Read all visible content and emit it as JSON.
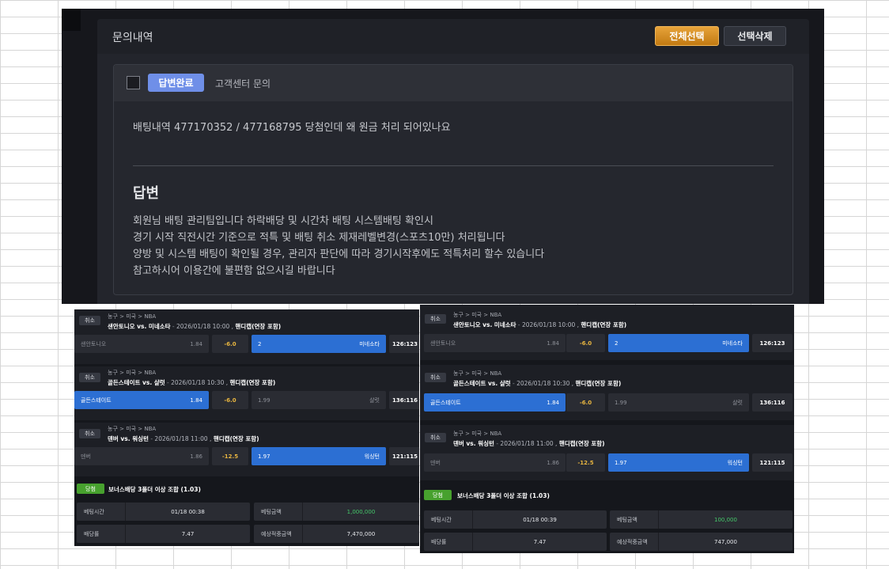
{
  "inquiry": {
    "title": "문의내역",
    "select_all_label": "전체선택",
    "delete_selected_label": "선택삭제",
    "status_badge": "답변완료",
    "category": "고객센터 문의",
    "question": "배팅내역 477170352 / 477168795 당첨인데 왜 원금 처리 되어있나요",
    "answer_heading": "답변",
    "answer_lines": [
      "회원님 배팅 관리팀입니다 하락배당 및 시간차 배팅 시스템배팅 확인시",
      "경기 시작 직전시간 기준으로 적특 및 배팅 취소 제재레벨변경(스포츠10만) 처리됩니다",
      "양방 및 시스템 배팅이 확인될 경우, 관리자 판단에 따라 경기시작후에도 적특처리 할수 있습니다",
      "참고하시어 이용간에 불편함 없으시길 바랍니다"
    ]
  },
  "slips": [
    {
      "games": [
        {
          "cancel": "취소",
          "path": "농구 > 미국 > NBA",
          "teams": "샌안토니오 vs. 미네소타",
          "sep": " - ",
          "date": "2026/01/18 10:00 ,",
          "market": "핸디캡(연장 포함)",
          "home": "샌안토니오",
          "home_odds": "1.84",
          "line": "-6.0",
          "away_odds": "2",
          "away": "미네소타",
          "score": "126:123",
          "selected": "away"
        },
        {
          "cancel": "취소",
          "path": "농구 > 미국 > NBA",
          "teams": "골든스테이트 vs. 샬럿",
          "sep": " - ",
          "date": "2026/01/18 10:30 ,",
          "market": "핸디캡(연장 포함)",
          "home": "골든스테이트",
          "home_odds": "1.84",
          "line": "-6.0",
          "away_odds": "1.99",
          "away": "샬럿",
          "score": "136:116",
          "selected": "home"
        },
        {
          "cancel": "취소",
          "path": "농구 > 미국 > NBA",
          "teams": "덴버 vs. 워싱턴",
          "sep": " - ",
          "date": "2026/01/18 11:00 ,",
          "market": "핸디캡(연장 포함)",
          "home": "덴버",
          "home_odds": "1.86",
          "line": "-12.5",
          "away_odds": "1.97",
          "away": "워싱턴",
          "score": "121:115",
          "selected": "away"
        }
      ],
      "bonus": {
        "badge": "당첨",
        "text": "보너스배당 3폴더 이상 조합 (1.03)"
      },
      "summary": {
        "bet_time_label": "베팅시간",
        "bet_time": "01/18 00:38",
        "bet_amount_label": "베팅금액",
        "bet_amount": "1,000,000",
        "odds_label": "배당률",
        "odds": "7.47",
        "expected_label": "예상적중금액",
        "expected": "7,470,000"
      }
    },
    {
      "games": [
        {
          "cancel": "취소",
          "path": "농구 > 미국 > NBA",
          "teams": "샌안토니오 vs. 미네소타",
          "sep": " - ",
          "date": "2026/01/18 10:00 ,",
          "market": "핸디캡(연장 포함)",
          "home": "샌안토니오",
          "home_odds": "1.84",
          "line": "-6.0",
          "away_odds": "2",
          "away": "미네소타",
          "score": "126:123",
          "selected": "away"
        },
        {
          "cancel": "취소",
          "path": "농구 > 미국 > NBA",
          "teams": "골든스테이트 vs. 샬럿",
          "sep": " - ",
          "date": "2026/01/18 10:30 ,",
          "market": "핸디캡(연장 포함)",
          "home": "골든스테이트",
          "home_odds": "1.84",
          "line": "-6.0",
          "away_odds": "1.99",
          "away": "샬럿",
          "score": "136:116",
          "selected": "home"
        },
        {
          "cancel": "취소",
          "path": "농구 > 미국 > NBA",
          "teams": "덴버 vs. 워싱턴",
          "sep": " - ",
          "date": "2026/01/18 11:00 ,",
          "market": "핸디캡(연장 포함)",
          "home": "덴버",
          "home_odds": "1.86",
          "line": "-12.5",
          "away_odds": "1.97",
          "away": "워싱턴",
          "score": "121:115",
          "selected": "away"
        }
      ],
      "bonus": {
        "badge": "당첨",
        "text": "보너스배당 3폴더 이상 조합 (1.03)"
      },
      "summary": {
        "bet_time_label": "베팅시간",
        "bet_time": "01/18 00:39",
        "bet_amount_label": "베팅금액",
        "bet_amount": "100,000",
        "odds_label": "배당률",
        "odds": "7.47",
        "expected_label": "예상적중금액",
        "expected": "747,000"
      }
    }
  ]
}
